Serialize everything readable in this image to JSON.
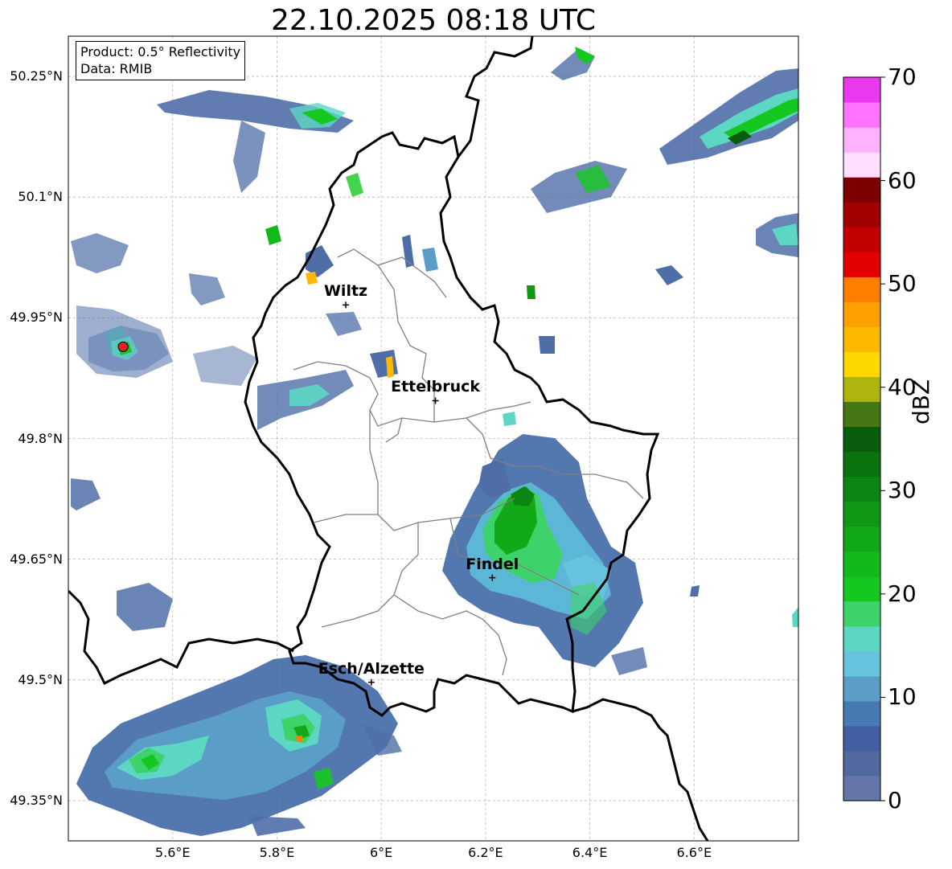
{
  "title": "22.10.2025 08:18 UTC",
  "info": {
    "product": "Product: 0.5° Reflectivity",
    "data": "Data: RMIB"
  },
  "map": {
    "lon_min": 5.4,
    "lon_max": 6.8,
    "lat_min": 49.3,
    "lat_max": 50.3,
    "lat_ticks": [
      {
        "value": 50.25,
        "label": "50.25°N"
      },
      {
        "value": 50.1,
        "label": "50.1°N"
      },
      {
        "value": 49.95,
        "label": "49.95°N"
      },
      {
        "value": 49.8,
        "label": "49.8°N"
      },
      {
        "value": 49.65,
        "label": "49.65°N"
      },
      {
        "value": 49.5,
        "label": "49.5°N"
      },
      {
        "value": 49.35,
        "label": "49.35°N"
      }
    ],
    "lon_ticks": [
      {
        "value": 5.6,
        "label": "5.6°E"
      },
      {
        "value": 5.8,
        "label": "5.8°E"
      },
      {
        "value": 6.0,
        "label": "6°E"
      },
      {
        "value": 6.2,
        "label": "6.2°E"
      },
      {
        "value": 6.4,
        "label": "6.4°E"
      },
      {
        "value": 6.6,
        "label": "6.6°E"
      }
    ],
    "grid": true,
    "radar_site": {
      "lon": 5.505,
      "lat": 49.914,
      "color": "#e32222"
    },
    "cities": [
      {
        "name": "Wiltz",
        "lon": 5.932,
        "lat": 49.966
      },
      {
        "name": "Ettelbruck",
        "lon": 6.104,
        "lat": 49.847
      },
      {
        "name": "Findel",
        "lon": 6.213,
        "lat": 49.627
      },
      {
        "name": "Esch/Alzette",
        "lon": 5.981,
        "lat": 49.497
      }
    ]
  },
  "colorbar": {
    "label": "dBZ",
    "min": 0,
    "max": 70,
    "ticks": [
      "0",
      "10",
      "20",
      "30",
      "40",
      "50",
      "60",
      "70"
    ],
    "colors": [
      "#6477a8",
      "#52699f",
      "#4360a2",
      "#4779b2",
      "#5a9ec7",
      "#67c2dd",
      "#5cd7c4",
      "#3dd36a",
      "#15c820",
      "#12b91a",
      "#12a817",
      "#0f9716",
      "#0d8512",
      "#0a730f",
      "#0a5c0d",
      "#457614",
      "#adb40b",
      "#fed700",
      "#fdb900",
      "#fe9f00",
      "#ff7e00",
      "#e30000",
      "#c30000",
      "#a10000",
      "#7c0000",
      "#ffdeff",
      "#ffb3ff",
      "#ff73fe",
      "#ea38ee"
    ]
  }
}
